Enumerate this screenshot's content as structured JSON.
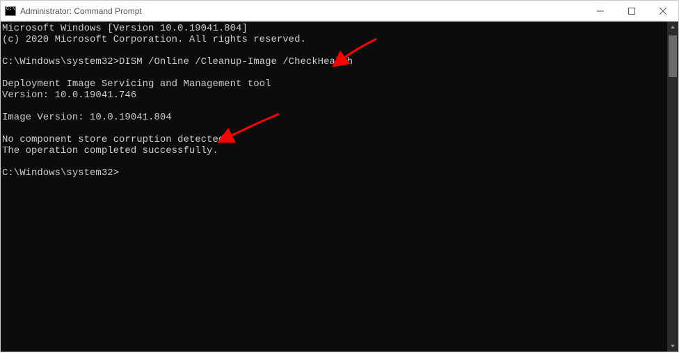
{
  "window": {
    "title": "Administrator: Command Prompt"
  },
  "console": {
    "banner_line1": "Microsoft Windows [Version 10.0.19041.804]",
    "banner_line2": "(c) 2020 Microsoft Corporation. All rights reserved.",
    "prompt1_path": "C:\\Windows\\system32>",
    "prompt1_command": "DISM /Online /Cleanup-Image /CheckHealth",
    "dism_title": "Deployment Image Servicing and Management tool",
    "dism_version": "Version: 10.0.19041.746",
    "image_version": "Image Version: 10.0.19041.804",
    "result_line1": "No component store corruption detected.",
    "result_line2": "The operation completed successfully.",
    "prompt2_path": "C:\\Windows\\system32>"
  },
  "annotations": {
    "arrow1_target": "command-input",
    "arrow2_target": "result-output",
    "arrow_color": "#ff0000"
  }
}
